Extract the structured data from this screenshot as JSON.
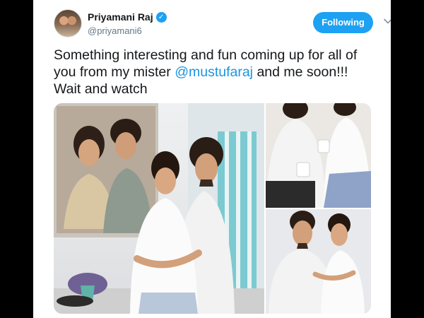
{
  "tweet": {
    "display_name": "Priyamani Raj",
    "handle": "@priyamani6",
    "follow_label": "Following",
    "text_before": "Something interesting and fun coming up for all of you from my mister ",
    "mention": "@mustufaraj",
    "text_after": " and me soon!!! Wait and watch",
    "icons": {
      "verified": "verified-badge-icon",
      "more": "chevron-down-icon"
    },
    "colors": {
      "accent": "#1da1f2",
      "mention": "#1b95e0",
      "text": "#14171a",
      "secondary": "#657786"
    },
    "media_count": 3
  }
}
